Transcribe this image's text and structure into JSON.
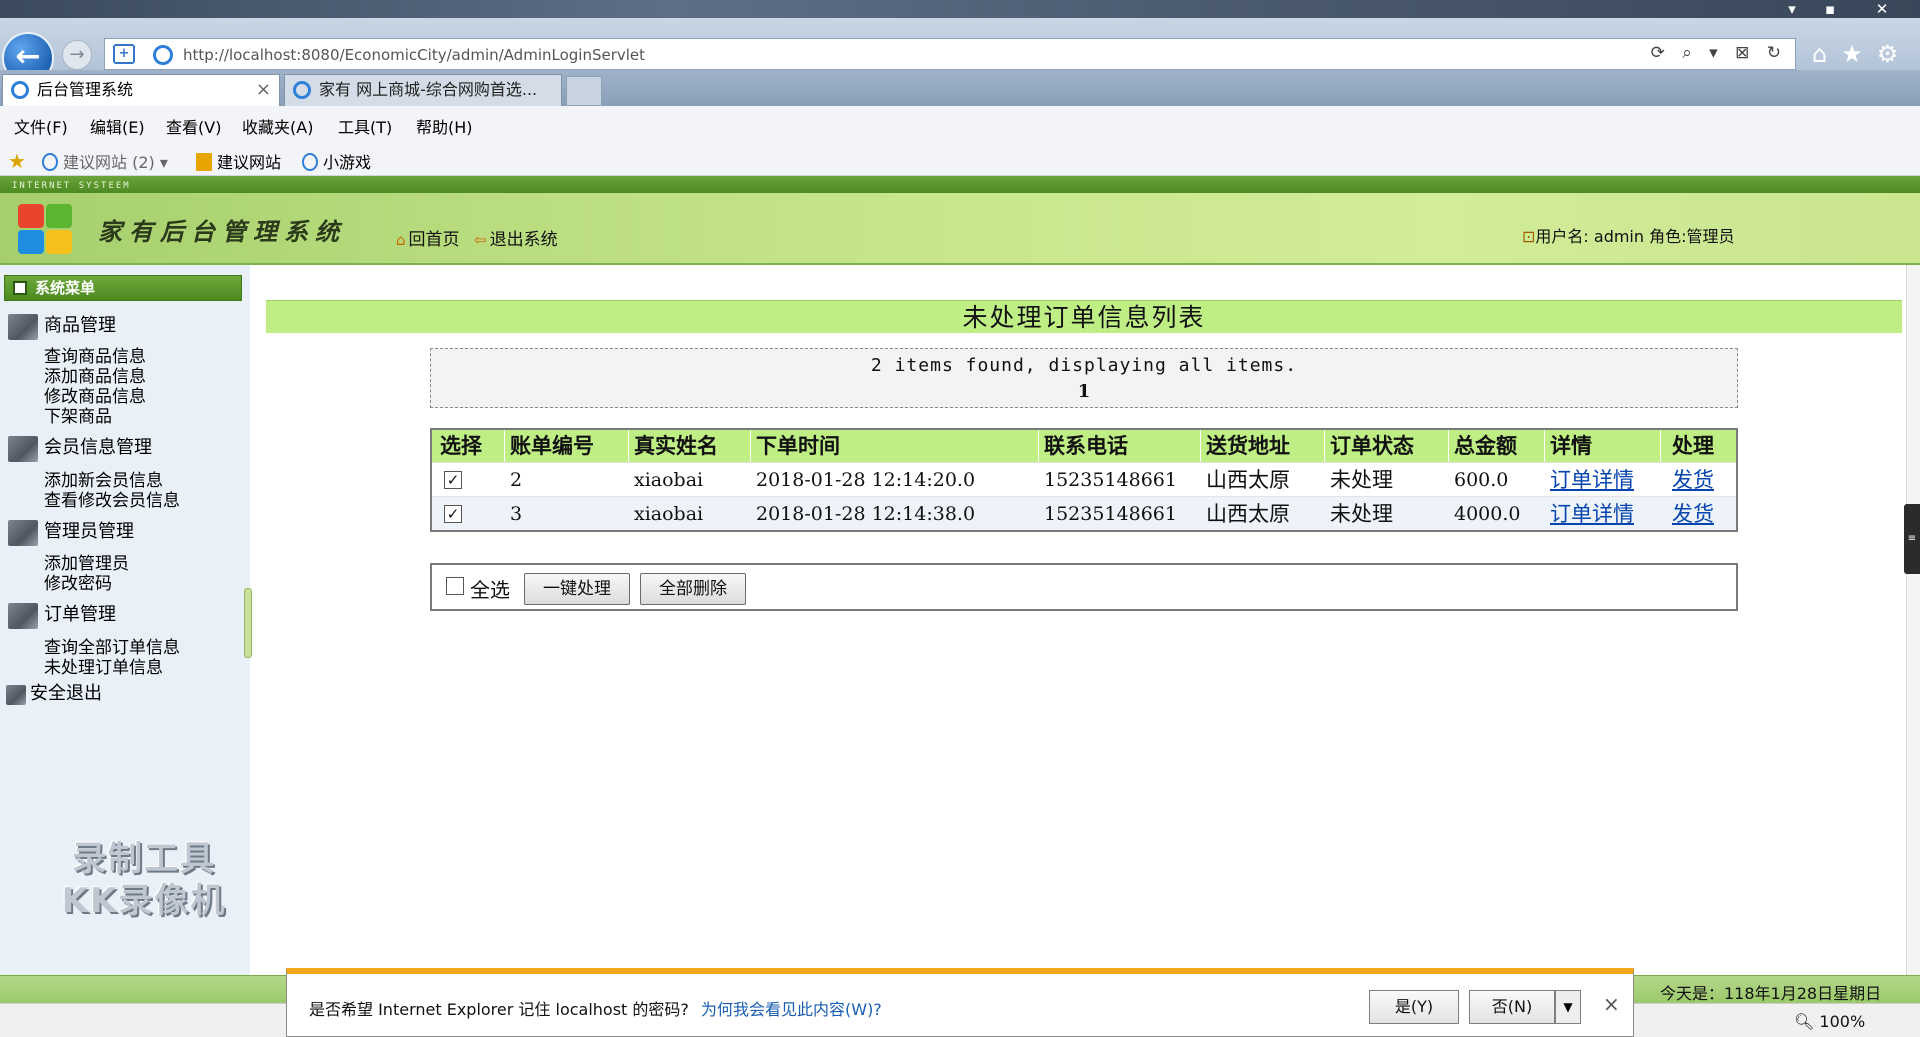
{
  "browser": {
    "address": "http://localhost:8080/EconomicCity/admin/AdminLoginServlet",
    "tabs": [
      {
        "label": "后台管理系统",
        "active": true
      },
      {
        "label": "家有 网上商城-综合网购首选...",
        "active": false
      }
    ],
    "menu": [
      "文件(F)",
      "编辑(E)",
      "查看(V)",
      "收藏夹(A)",
      "工具(T)",
      "帮助(H)"
    ],
    "favorites": [
      "建议网站 (2)",
      "建议网站",
      "小游戏"
    ],
    "zoom": "100%"
  },
  "app": {
    "strip_text": "INTERNET SYSTEEM",
    "title": "家有后台管理系统",
    "nav_home": "回首页",
    "nav_logout": "退出系统",
    "user_info": "用户名: admin  角色:管理员"
  },
  "sidebar": {
    "header": "系统菜单",
    "sections": [
      {
        "label": "商品管理",
        "items": [
          "查询商品信息",
          "添加商品信息",
          "修改商品信息",
          "下架商品"
        ]
      },
      {
        "label": "会员信息管理",
        "items": [
          "添加新会员信息",
          "查看修改会员信息"
        ]
      },
      {
        "label": "管理员管理",
        "items": [
          "添加管理员",
          "修改密码"
        ]
      },
      {
        "label": "订单管理",
        "items": [
          "查询全部订单信息",
          "未处理订单信息"
        ]
      }
    ],
    "logout": "安全退出",
    "watermark_line1": "录制工具",
    "watermark_line2": "KK录像机"
  },
  "content": {
    "title": "未处理订单信息列表",
    "pager_text": "2 items found, displaying all items.",
    "page_number": "1",
    "columns": [
      "选择",
      "账单编号",
      "真实姓名",
      "下单时间",
      "联系电话",
      "送货地址",
      "订单状态",
      "总金额",
      "详情",
      "处理"
    ],
    "rows": [
      {
        "id": "2",
        "name": "xiaobai",
        "time": "2018-01-28 12:14:20.0",
        "phone": "15235148661",
        "address": "山西太原",
        "status": "未处理",
        "total": "600.0",
        "detail": "订单详情",
        "action": "发货",
        "checked": true
      },
      {
        "id": "3",
        "name": "xiaobai",
        "time": "2018-01-28 12:14:38.0",
        "phone": "15235148661",
        "address": "山西太原",
        "status": "未处理",
        "total": "4000.0",
        "detail": "订单详情",
        "action": "发货",
        "checked": true
      }
    ],
    "select_all": "全选",
    "btn_process_all": "一键处理",
    "btn_delete_all": "全部删除"
  },
  "status": {
    "today": "今天是：118年1月28日星期日"
  },
  "notification": {
    "text": "是否希望 Internet Explorer 记住 localhost 的密码?",
    "link": "为何我会看见此内容(W)?",
    "yes": "是(Y)",
    "no": "否(N)"
  }
}
